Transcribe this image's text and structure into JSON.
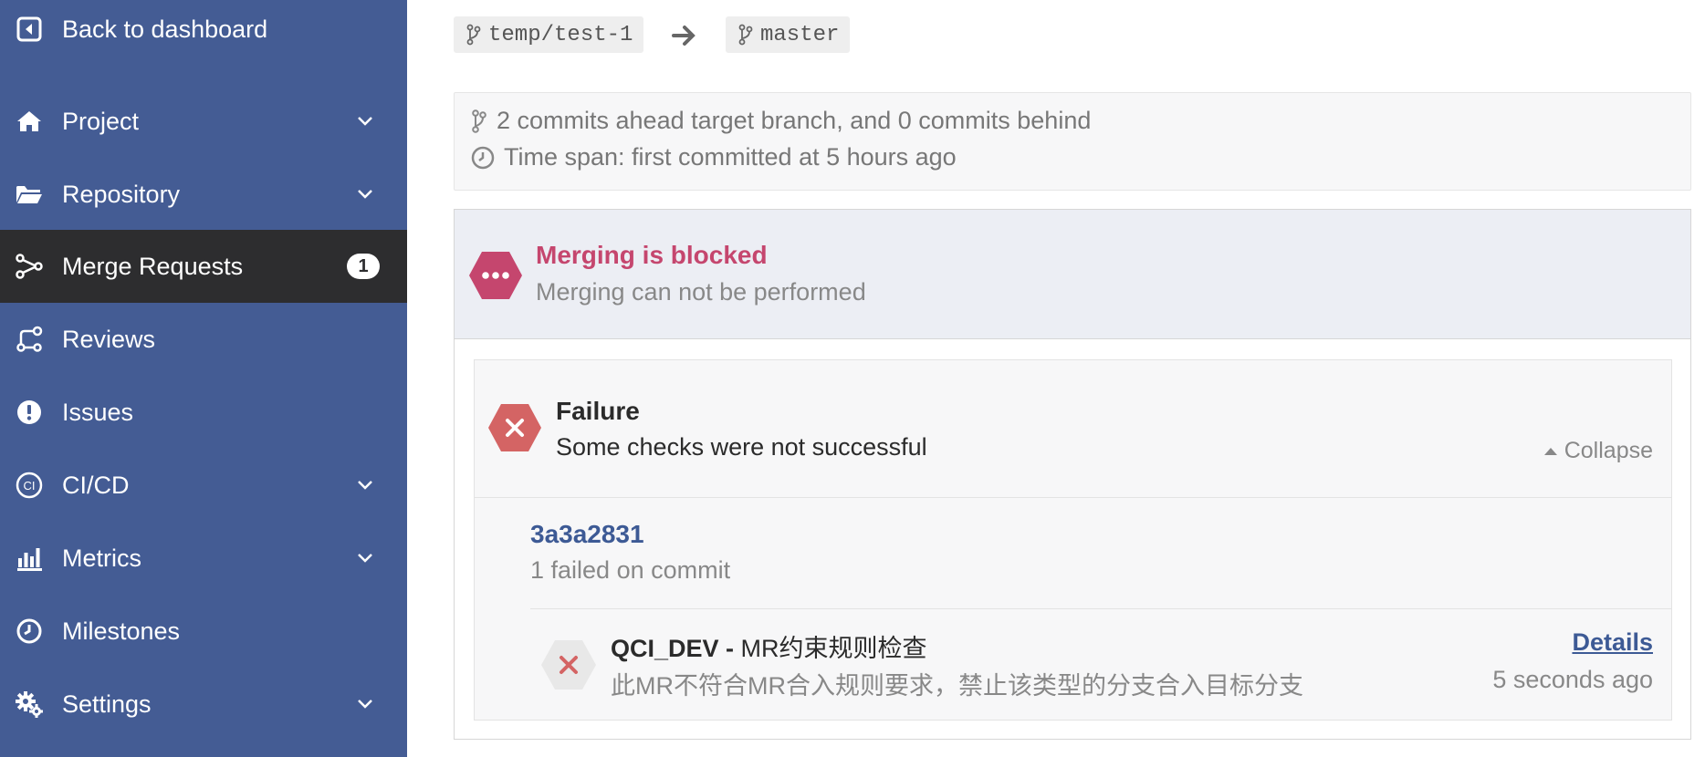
{
  "sidebar": {
    "back_label": "Back to dashboard",
    "items": [
      {
        "label": "Project",
        "icon": "home-icon",
        "has_chevron": true
      },
      {
        "label": "Repository",
        "icon": "folder-open-icon",
        "has_chevron": true
      },
      {
        "label": "Merge Requests",
        "icon": "merge-request-icon",
        "badge": "1",
        "active": true
      },
      {
        "label": "Reviews",
        "icon": "review-icon"
      },
      {
        "label": "Issues",
        "icon": "exclamation-circle-icon"
      },
      {
        "label": "CI/CD",
        "icon": "ci-icon",
        "has_chevron": true
      },
      {
        "label": "Metrics",
        "icon": "bar-chart-icon",
        "has_chevron": true
      },
      {
        "label": "Milestones",
        "icon": "clock-icon"
      },
      {
        "label": "Settings",
        "icon": "gears-icon",
        "has_chevron": true
      }
    ],
    "colors": {
      "background": "#445c94",
      "active_background": "#2d2d2f"
    }
  },
  "branches": {
    "source": "temp/test-1",
    "target": "master"
  },
  "info": {
    "commits_line": "2 commits ahead target branch, and 0 commits behind",
    "time_line": "Time span: first committed at 5 hours ago"
  },
  "merge_status": {
    "title": "Merging is blocked",
    "subtitle": "Merging can not be performed",
    "color": "#c5466e"
  },
  "checks": {
    "status_title": "Failure",
    "status_subtitle": "Some checks were not successful",
    "collapse_label": "Collapse",
    "commit_hash": "3a3a2831",
    "commit_summary": "1 failed on commit",
    "items": [
      {
        "name": "QCI_DEV -",
        "rule": "MR约束规则检查",
        "description": "此MR不符合MR合入规则要求，禁止该类型的分支合入目标分支",
        "details_label": "Details",
        "time": "5 seconds ago"
      }
    ],
    "fail_color": "#d46464"
  }
}
